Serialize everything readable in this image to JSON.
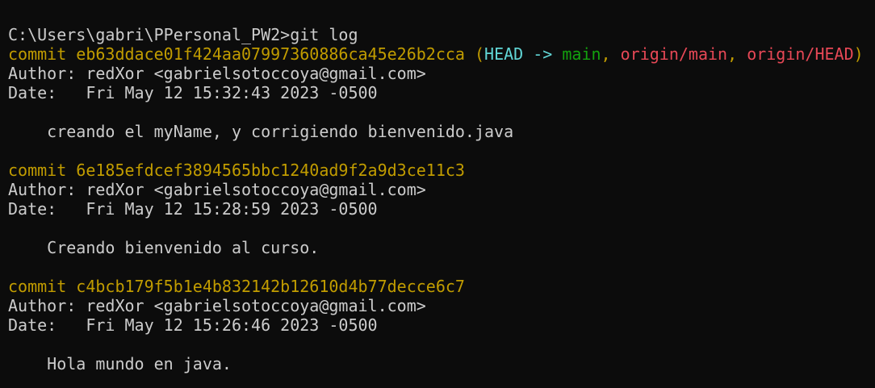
{
  "prompt": {
    "path": "C:\\Users\\gabri\\PPersonal_PW2>",
    "command": "git log"
  },
  "refs": {
    "open": "(",
    "head": "HEAD",
    "arrow": " -> ",
    "main": "main",
    "sep1": ", ",
    "origin_main": "origin/main",
    "sep2": ", ",
    "origin_head": "origin/HEAD",
    "close": ")"
  },
  "commits": [
    {
      "keyword": "commit",
      "hash": "eb63ddace01f424aa07997360886ca45e26b2cca",
      "author_label": "Author:",
      "author": "redXor <gabrielsotoccoya@gmail.com>",
      "date_label": "Date:",
      "date": "Fri May 12 15:32:43 2023 -0500",
      "message": "creando el myName, y corrigiendo bienvenido.java"
    },
    {
      "keyword": "commit",
      "hash": "6e185efdcef3894565bbc1240ad9f2a9d3ce11c3",
      "author_label": "Author:",
      "author": "redXor <gabrielsotoccoya@gmail.com>",
      "date_label": "Date:",
      "date": "Fri May 12 15:28:59 2023 -0500",
      "message": "Creando bienvenido al curso."
    },
    {
      "keyword": "commit",
      "hash": "c4bcb179f5b1e4b832142b12610d4b77decce6c7",
      "author_label": "Author:",
      "author": "redXor <gabrielsotoccoya@gmail.com>",
      "date_label": "Date:",
      "date": "Fri May 12 15:26:46 2023 -0500",
      "message": "Hola mundo en java."
    }
  ],
  "colors": {
    "background": "#0c0c0c",
    "text": "#cccccc",
    "commit": "#c19c00",
    "head": "#61d6d6",
    "branch_local": "#13a10e",
    "branch_remote": "#e74856"
  }
}
